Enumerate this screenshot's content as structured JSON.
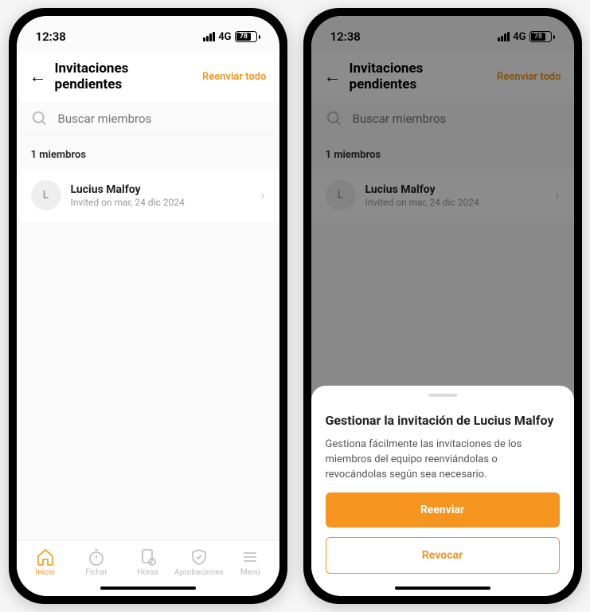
{
  "status": {
    "time": "12:38",
    "network": "4G",
    "battery": "78"
  },
  "header": {
    "title": "Invitaciones pendientes",
    "resend_all": "Reenviar todo"
  },
  "search": {
    "placeholder": "Buscar miembros"
  },
  "section": {
    "count_label": "1 miembros"
  },
  "member": {
    "avatar_initial": "L",
    "name": "Lucius Malfoy",
    "invited_on": "Invited on mar, 24 dic 2024"
  },
  "tabs": {
    "home": "Inicio",
    "clock": "Fichar",
    "hours": "Horas",
    "approvals": "Aprobaciones",
    "menu": "Menú"
  },
  "sheet": {
    "title": "Gestionar la invitación de Lucius Malfoy",
    "description": "Gestiona fácilmente las invitaciones de los miembros del equipo reenviándolas o revocándolas según sea necesario.",
    "resend": "Reenviar",
    "revoke": "Revocar"
  }
}
